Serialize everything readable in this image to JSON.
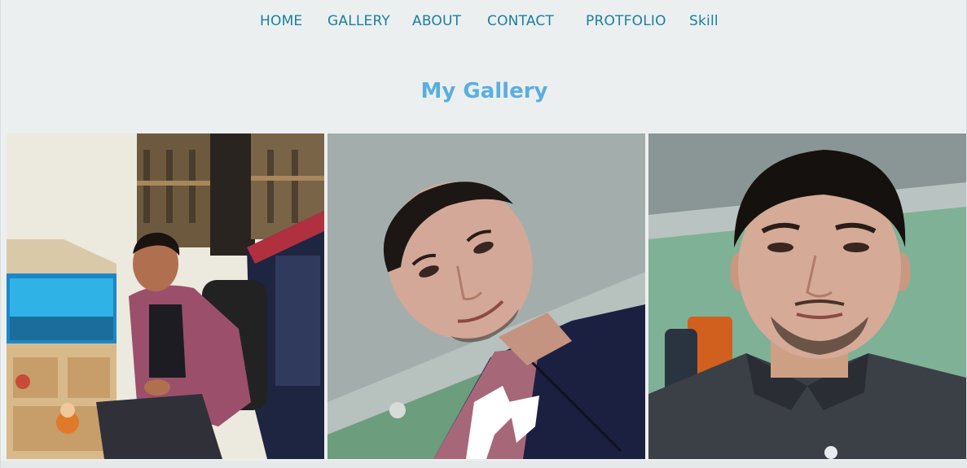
{
  "nav": {
    "items": [
      {
        "label": "HOME"
      },
      {
        "label": "GALLERY"
      },
      {
        "label": "ABOUT"
      },
      {
        "label": "CONTACT"
      },
      {
        "label": "PROTFOLIO"
      },
      {
        "label": "Skill"
      }
    ],
    "color": "#1c7f9d"
  },
  "gallery": {
    "title": "My Gallery",
    "title_color": "#5aaee0",
    "photos": [
      {
        "subject": "person-seated-by-aquarium"
      },
      {
        "subject": "tilted-selfie"
      },
      {
        "subject": "front-selfie"
      }
    ]
  }
}
